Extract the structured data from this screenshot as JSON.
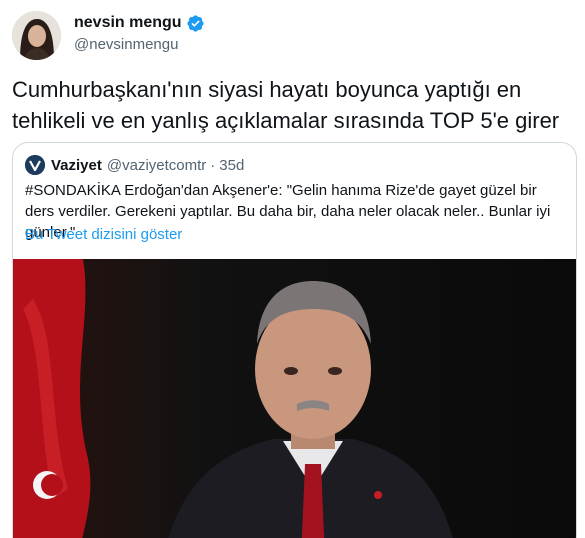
{
  "author": {
    "name": "nevsin mengu",
    "handle": "@nevsinmengu",
    "avatar_icon": "profile-photo",
    "verified_icon": "verified-badge-icon"
  },
  "tweet": {
    "text": "Cumhurbaşkanı'nın siyasi hayatı boyunca yaptığı en tehlikeli ve en yanlış açıklamalar sırasında TOP 5'e girer"
  },
  "quote": {
    "name": "Vaziyet",
    "handle": "@vaziyetcomtr",
    "separator": "·",
    "time": "35d",
    "text": "#SONDAKİKA Erdoğan'dan Akşener'e: \"Gelin hanıma Rize'de gayet güzel bir ders verdiler. Gerekeni yaptılar. Bu daha bir, daha neler olacak neler.. Bunlar iyi günler.\"",
    "thread_link": "Bu Tweet dizisini göster",
    "media_icon": "news-photo"
  },
  "colors": {
    "link": "#1d9bf0",
    "muted": "#536471",
    "border": "#cfd9de",
    "text": "#0f1419"
  }
}
